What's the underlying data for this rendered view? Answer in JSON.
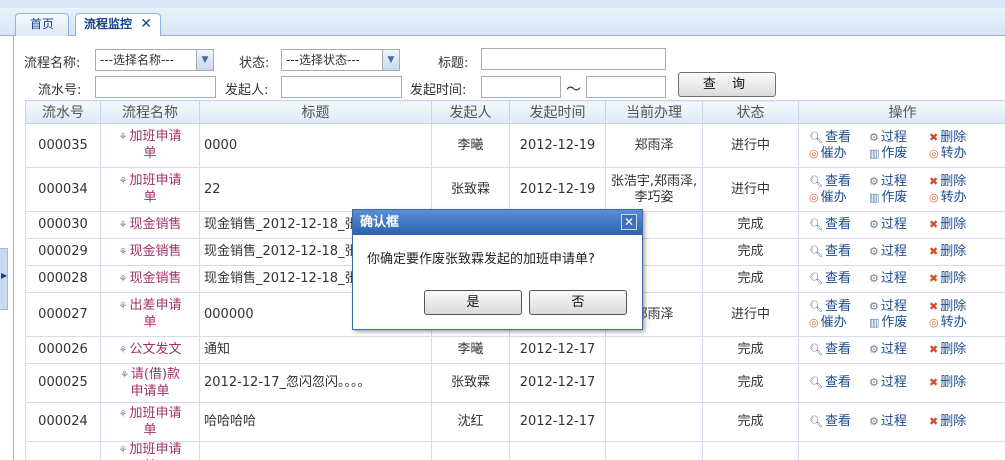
{
  "tabs": {
    "home": "首页",
    "active": "流程监控",
    "close_glyph": "✕"
  },
  "search": {
    "name_label": "流程名称:",
    "name_select": "---选择名称---",
    "status_label": "状态:",
    "status_select": "---选择状态---",
    "title_label": "标题:",
    "title_value": "",
    "serial_label": "流水号:",
    "serial_value": "",
    "initiator_label": "发起人:",
    "initiator_value": "",
    "time_label": "发起时间:",
    "time_from": "",
    "time_sep": "～",
    "time_to": "",
    "query_button": "查 询"
  },
  "grid": {
    "headers": [
      "流水号",
      "流程名称",
      "标题",
      "发起人",
      "发起时间",
      "当前办理",
      "状态",
      "操作"
    ],
    "rows": [
      {
        "serial": "000035",
        "process": "加班申请单",
        "title": "0000",
        "initiator": "李曦",
        "time": "2012-12-19",
        "handler": "郑雨泽",
        "status": "进行中",
        "ops": [
          "查看",
          "过程",
          "删除",
          "催办",
          "作废",
          "转办"
        ]
      },
      {
        "serial": "000034",
        "process": "加班申请单",
        "title": "22",
        "initiator": "张致霖",
        "time": "2012-12-19",
        "handler": "张浩宇,郑雨泽,李巧姿",
        "status": "进行中",
        "ops": [
          "查看",
          "过程",
          "删除",
          "催办",
          "作废",
          "转办"
        ]
      },
      {
        "serial": "000030",
        "process": "现金销售",
        "title": "现金销售_2012-12-18_张",
        "initiator": "",
        "time": "",
        "handler": "",
        "status": "完成",
        "ops": [
          "查看",
          "过程",
          "删除"
        ]
      },
      {
        "serial": "000029",
        "process": "现金销售",
        "title": "现金销售_2012-12-18_张",
        "initiator": "",
        "time": "",
        "handler": "",
        "status": "完成",
        "ops": [
          "查看",
          "过程",
          "删除"
        ]
      },
      {
        "serial": "000028",
        "process": "现金销售",
        "title": "现金销售_2012-12-18_张",
        "initiator": "",
        "time": "",
        "handler": "",
        "status": "完成",
        "ops": [
          "查看",
          "过程",
          "删除"
        ]
      },
      {
        "serial": "000027",
        "process": "出差申请单",
        "title": "000000",
        "initiator": "",
        "time": "",
        "handler": "郑雨泽",
        "status": "进行中",
        "ops": [
          "查看",
          "过程",
          "删除",
          "催办",
          "作废",
          "转办"
        ]
      },
      {
        "serial": "000026",
        "process": "公文发文",
        "title": "通知",
        "initiator": "李曦",
        "time": "2012-12-17",
        "handler": "",
        "status": "完成",
        "ops": [
          "查看",
          "过程",
          "删除"
        ]
      },
      {
        "serial": "000025",
        "process": "请(借)款申请单",
        "title": "2012-12-17_忽闪忽闪。。。。",
        "initiator": "张致霖",
        "time": "2012-12-17",
        "handler": "",
        "status": "完成",
        "ops": [
          "查看",
          "过程",
          "删除"
        ]
      },
      {
        "serial": "000024",
        "process": "加班申请单",
        "title": "哈哈哈哈",
        "initiator": "沈红",
        "time": "2012-12-17",
        "handler": "",
        "status": "完成",
        "ops": [
          "查看",
          "过程",
          "删除"
        ]
      },
      {
        "serial": "",
        "process": "加班申请单",
        "title": "",
        "initiator": "",
        "time": "",
        "handler": "",
        "status": "",
        "ops": []
      }
    ]
  },
  "dialog": {
    "title": "确认框",
    "close_glyph": "✕",
    "message": "你确定要作废张致霖发起的加班申请单?",
    "yes": "是",
    "no": "否"
  },
  "icons": {
    "op_icons": {
      "查看": "magnifier-icon",
      "过程": "process-icon",
      "删除": "delete-icon",
      "催办": "urge-icon",
      "作废": "void-icon",
      "转办": "transfer-icon"
    },
    "process_icon": "flow-icon"
  },
  "colors": {
    "header_blue": "#2e61ad",
    "link_blue": "#1c4c91",
    "process_purple": "#a1316a",
    "border_blue": "#99bbe8"
  }
}
